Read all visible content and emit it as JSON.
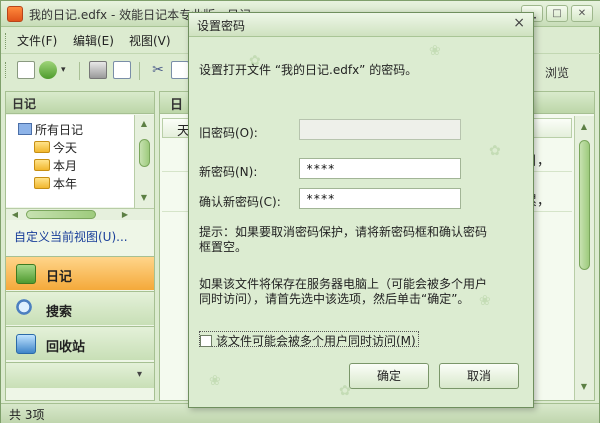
{
  "app": {
    "title": "我的日记.edfx - 效能日记本专业版 - 日记",
    "menu": [
      "文件(F)",
      "编辑(E)",
      "视图(V)"
    ],
    "toolbar_right_label": "浏览",
    "left_pane": {
      "header": "日记",
      "tree": {
        "root": "所有日记",
        "items": [
          "今天",
          "本月",
          "本年"
        ]
      },
      "custom_view_link": "自定义当前视图(U)...",
      "nav": [
        {
          "label": "日记",
          "icon": "diary-icon",
          "active": true
        },
        {
          "label": "搜索",
          "icon": "search-icon",
          "active": false
        },
        {
          "label": "回收站",
          "icon": "recycle-bin-icon",
          "active": false
        }
      ]
    },
    "right_pane": {
      "header": "日",
      "column_header": "天",
      "lines": [
        "生日，",
        "很累，"
      ]
    },
    "status": "共 3项"
  },
  "dialog": {
    "title": "设置密码",
    "close": "×",
    "description": "设置打开文件 “我的日记.edfx” 的密码。",
    "old_password_label": "旧密码(O):",
    "old_password_value": "",
    "new_password_label": "新密码(N):",
    "new_password_value": "****",
    "confirm_password_label": "确认新密码(C):",
    "confirm_password_value": "****",
    "hint_line1": "提示：如果要取消密码保护，请将新密码框和确认密码",
    "hint_line2": "框置空。",
    "server_hint_line1": "如果该文件将保存在服务器电脑上（可能会被多个用户",
    "server_hint_line2": "同时访问），请首先选中该选项，然后单击“确定”。",
    "checkbox_label": "该文件可能会被多个用户同时访问(M)",
    "checkbox_checked": false,
    "ok_label": "确定",
    "cancel_label": "取消"
  },
  "colors": {
    "accent_nav_active": "#f4a93a",
    "window_green": "#dcebd0",
    "link_blue": "#1a3f9a"
  }
}
